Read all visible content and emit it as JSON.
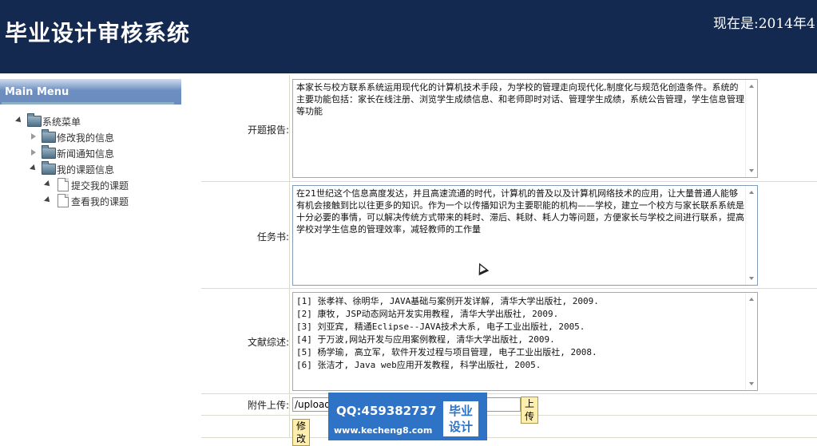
{
  "header": {
    "title": "毕业设计审核系统",
    "clock": "现在是:2014年4"
  },
  "sidebar": {
    "menu_title": "Main Menu",
    "tree": {
      "root": "系统菜单",
      "items": [
        {
          "label": "修改我的信息"
        },
        {
          "label": "新闻通知信息"
        },
        {
          "label": "我的课题信息",
          "children": [
            {
              "label": "提交我的课题"
            },
            {
              "label": "查看我的课题"
            }
          ]
        }
      ]
    }
  },
  "form": {
    "opening_report": {
      "label": "开题报告:",
      "value": "本家长与校方联系系统运用现代化的计算机技术手段，为学校的管理走向现代化,制度化与规范化创造条件。系统的主要功能包括：家长在线注册、浏览学生成绩信息、和老师即时对话、管理学生成绩，系统公告管理，学生信息管理等功能"
    },
    "task_book": {
      "label": "任务书:",
      "value": "在21世纪这个信息高度发达，并且高速流通的时代，计算机的普及以及计算机网络技术的应用，让大量普通人能够有机会接触到比以往更多的知识。作为一个以传播知识为主要职能的机构——学校，建立一个校方与家长联系系统是十分必要的事情，可以解决传统方式带来的耗时、滞后、耗财、耗人力等问题，方便家长与学校之间进行联系，提高学校对学生信息的管理效率，减轻教师的工作量"
    },
    "literature_review": {
      "label": "文献综述:",
      "lines": [
        "[1] 张孝祥、徐明华, JAVA基础与案例开发详解, 清华大学出版社, 2009.",
        "[2] 康牧, JSP动态网站开发实用教程, 清华大学出版社, 2009.",
        "[3] 刘亚宾, 精通Eclipse--JAVA技术大系, 电子工业出版社, 2005.",
        "[4] 于万波,网站开发与应用案例教程, 清华大学出版社, 2009.",
        "[5] 杨学瑜, 高立军, 软件开发过程与项目管理, 电子工业出版社, 2008.",
        "[6] 张洁才, Java web应用开发教程, 科学出版社, 2005."
      ]
    },
    "attachment": {
      "label": "附件上传:",
      "path_value": "/upload/",
      "upload_button": "上传"
    },
    "modify_button": "修改"
  },
  "watermark": {
    "qq": "QQ:459382737",
    "url": "www.kecheng8.com",
    "badge_line1": "毕业",
    "badge_line2": "设计"
  }
}
